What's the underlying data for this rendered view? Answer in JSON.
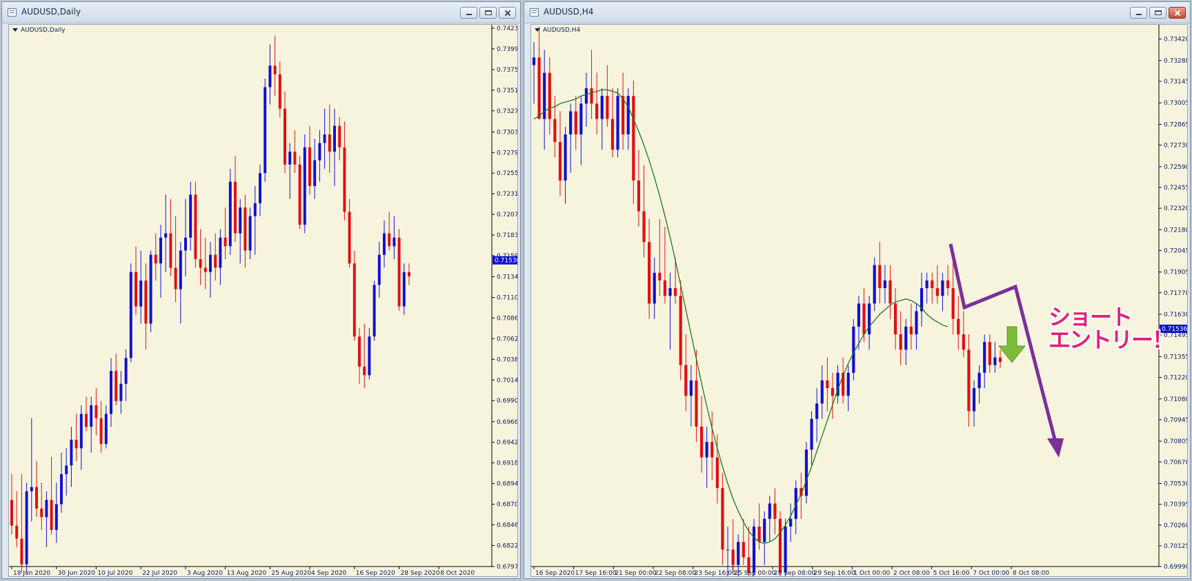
{
  "windows": [
    {
      "id": "daily",
      "title": "AUDUSD,Daily",
      "symbol_label": "AUDUSD,Daily"
    },
    {
      "id": "h4",
      "title": "AUDUSD,H4",
      "symbol_label": "AUDUSD,H4",
      "annotation": [
        "ショート",
        "エントリー！"
      ]
    }
  ],
  "colors": {
    "background": "#f7f4de",
    "bull": "#1010d0",
    "bear": "#e01010",
    "ma": "#1a7a1a",
    "bid_label": "#1010d0",
    "arrow": "#7b2f9b",
    "entry_arrow": "#7cbc3a",
    "annotation": "#e51e78"
  },
  "chart_data": [
    {
      "type": "candlestick",
      "title": "AUDUSD,Daily",
      "ylim": [
        0.67975,
        0.74235
      ],
      "y_ticks": [
        "0.74235",
        "0.73995",
        "0.73755",
        "0.73515",
        "0.73275",
        "0.73030",
        "0.72790",
        "0.72550",
        "0.72310",
        "0.72070",
        "0.71830",
        "0.71590",
        "0.71345",
        "0.71105",
        "0.70865",
        "0.70625",
        "0.70385",
        "0.70145",
        "0.69905",
        "0.69660",
        "0.69420",
        "0.69180",
        "0.68940",
        "0.68700",
        "0.68460",
        "0.68220",
        "0.67975"
      ],
      "x_ticks": [
        "18 Jun 2020",
        "30 Jun 2020",
        "10 Jul 2020",
        "22 Jul 2020",
        "3 Aug 2020",
        "13 Aug 2020",
        "25 Aug 2020",
        "4 Sep 2020",
        "16 Sep 2020",
        "28 Sep 2020",
        "8 Oct 2020"
      ],
      "x_tick_index": [
        0,
        9,
        17,
        26,
        35,
        43,
        52,
        60,
        69,
        78,
        86
      ],
      "current_price": "0.71536",
      "ohlc": [
        [
          0.6875,
          0.6905,
          0.6835,
          0.6845
        ],
        [
          0.6845,
          0.6885,
          0.682,
          0.683
        ],
        [
          0.683,
          0.6905,
          0.679,
          0.68
        ],
        [
          0.68,
          0.6895,
          0.679,
          0.6885
        ],
        [
          0.6885,
          0.697,
          0.685,
          0.689
        ],
        [
          0.689,
          0.692,
          0.6855,
          0.6865
        ],
        [
          0.6865,
          0.6895,
          0.684,
          0.6855
        ],
        [
          0.6855,
          0.6885,
          0.682,
          0.6875
        ],
        [
          0.6875,
          0.6925,
          0.6835,
          0.684
        ],
        [
          0.684,
          0.6895,
          0.6825,
          0.687
        ],
        [
          0.687,
          0.693,
          0.686,
          0.6905
        ],
        [
          0.6905,
          0.6935,
          0.688,
          0.6915
        ],
        [
          0.6915,
          0.696,
          0.689,
          0.6945
        ],
        [
          0.6945,
          0.6975,
          0.692,
          0.6935
        ],
        [
          0.6935,
          0.6985,
          0.691,
          0.6975
        ],
        [
          0.6975,
          0.6995,
          0.6955,
          0.696
        ],
        [
          0.696,
          0.6995,
          0.693,
          0.6985
        ],
        [
          0.6985,
          0.7005,
          0.695,
          0.697
        ],
        [
          0.697,
          0.699,
          0.693,
          0.694
        ],
        [
          0.694,
          0.6985,
          0.6935,
          0.6975
        ],
        [
          0.6975,
          0.704,
          0.696,
          0.7025
        ],
        [
          0.7025,
          0.7045,
          0.6985,
          0.699
        ],
        [
          0.699,
          0.7025,
          0.6975,
          0.701
        ],
        [
          0.701,
          0.705,
          0.699,
          0.704
        ],
        [
          0.704,
          0.715,
          0.7035,
          0.714
        ],
        [
          0.714,
          0.717,
          0.709,
          0.71
        ],
        [
          0.71,
          0.7165,
          0.708,
          0.713
        ],
        [
          0.713,
          0.715,
          0.705,
          0.708
        ],
        [
          0.708,
          0.7165,
          0.707,
          0.716
        ],
        [
          0.716,
          0.7185,
          0.713,
          0.715
        ],
        [
          0.715,
          0.7195,
          0.711,
          0.718
        ],
        [
          0.718,
          0.723,
          0.714,
          0.7185
        ],
        [
          0.7185,
          0.7225,
          0.7135,
          0.7145
        ],
        [
          0.7145,
          0.7205,
          0.7105,
          0.712
        ],
        [
          0.712,
          0.7175,
          0.708,
          0.7165
        ],
        [
          0.7165,
          0.7225,
          0.7135,
          0.718
        ],
        [
          0.718,
          0.7245,
          0.7165,
          0.723
        ],
        [
          0.723,
          0.7245,
          0.7145,
          0.7155
        ],
        [
          0.7155,
          0.719,
          0.7125,
          0.7145
        ],
        [
          0.7145,
          0.718,
          0.712,
          0.714
        ],
        [
          0.714,
          0.7175,
          0.711,
          0.716
        ],
        [
          0.716,
          0.7185,
          0.713,
          0.7145
        ],
        [
          0.7145,
          0.719,
          0.7125,
          0.718
        ],
        [
          0.718,
          0.7215,
          0.7155,
          0.717
        ],
        [
          0.717,
          0.726,
          0.716,
          0.7245
        ],
        [
          0.7245,
          0.7275,
          0.7175,
          0.7185
        ],
        [
          0.7185,
          0.7225,
          0.715,
          0.7215
        ],
        [
          0.7215,
          0.723,
          0.7145,
          0.7165
        ],
        [
          0.7165,
          0.7215,
          0.7155,
          0.7205
        ],
        [
          0.7205,
          0.724,
          0.716,
          0.722
        ],
        [
          0.722,
          0.7265,
          0.7205,
          0.7255
        ],
        [
          0.7255,
          0.7365,
          0.7245,
          0.7355
        ],
        [
          0.7355,
          0.7405,
          0.7335,
          0.738
        ],
        [
          0.738,
          0.7415,
          0.7345,
          0.737
        ],
        [
          0.737,
          0.7385,
          0.732,
          0.733
        ],
        [
          0.733,
          0.735,
          0.7255,
          0.7265
        ],
        [
          0.7265,
          0.729,
          0.7225,
          0.728
        ],
        [
          0.728,
          0.7305,
          0.7255,
          0.7265
        ],
        [
          0.7265,
          0.7275,
          0.719,
          0.7195
        ],
        [
          0.7195,
          0.73,
          0.7185,
          0.7285
        ],
        [
          0.7285,
          0.731,
          0.723,
          0.724
        ],
        [
          0.724,
          0.7295,
          0.7225,
          0.727
        ],
        [
          0.727,
          0.7305,
          0.7245,
          0.729
        ],
        [
          0.729,
          0.733,
          0.726,
          0.73
        ],
        [
          0.73,
          0.7335,
          0.7255,
          0.728
        ],
        [
          0.728,
          0.733,
          0.724,
          0.731
        ],
        [
          0.731,
          0.732,
          0.727,
          0.7285
        ],
        [
          0.7285,
          0.7315,
          0.72,
          0.721
        ],
        [
          0.721,
          0.7225,
          0.7145,
          0.715
        ],
        [
          0.715,
          0.7165,
          0.706,
          0.7065
        ],
        [
          0.7065,
          0.7075,
          0.701,
          0.703
        ],
        [
          0.703,
          0.708,
          0.7005,
          0.702
        ],
        [
          0.702,
          0.7075,
          0.7015,
          0.7065
        ],
        [
          0.7065,
          0.713,
          0.706,
          0.7125
        ],
        [
          0.7125,
          0.7175,
          0.711,
          0.716
        ],
        [
          0.716,
          0.72,
          0.7145,
          0.7185
        ],
        [
          0.7185,
          0.721,
          0.7165,
          0.717
        ],
        [
          0.717,
          0.7205,
          0.7155,
          0.718
        ],
        [
          0.718,
          0.719,
          0.7095,
          0.71
        ],
        [
          0.71,
          0.715,
          0.709,
          0.714
        ],
        [
          0.714,
          0.715,
          0.7125,
          0.7135
        ]
      ]
    },
    {
      "type": "candlestick",
      "title": "AUDUSD,H4",
      "ylim": [
        0.6999,
        0.7349
      ],
      "y_ticks": [
        "0.73420",
        "0.73280",
        "0.73145",
        "0.73005",
        "0.72865",
        "0.72730",
        "0.72590",
        "0.72455",
        "0.72320",
        "0.72180",
        "0.72045",
        "0.71905",
        "0.71770",
        "0.71630",
        "0.71495",
        "0.71355",
        "0.71220",
        "0.71080",
        "0.70945",
        "0.70805",
        "0.70670",
        "0.70530",
        "0.70395",
        "0.70260",
        "0.70125",
        "0.69990"
      ],
      "x_ticks": [
        "16 Sep 2020",
        "17 Sep 16:00",
        "21 Sep 00:00",
        "22 Sep 08:00",
        "23 Sep 16:00",
        "25 Sep 00:00",
        "28 Sep 08:00",
        "29 Sep 16:00",
        "1 Oct 00:00",
        "2 Oct 08:00",
        "5 Oct 16:00",
        "7 Oct 00:00",
        "8 Oct 08:00"
      ],
      "current_price": "0.71536",
      "ohlc": [
        [
          0.7325,
          0.734,
          0.73,
          0.733
        ],
        [
          0.733,
          0.735,
          0.729,
          0.729
        ],
        [
          0.729,
          0.7335,
          0.727,
          0.732
        ],
        [
          0.732,
          0.733,
          0.728,
          0.729
        ],
        [
          0.729,
          0.7305,
          0.7265,
          0.7275
        ],
        [
          0.7275,
          0.7295,
          0.724,
          0.725
        ],
        [
          0.725,
          0.7285,
          0.7235,
          0.728
        ],
        [
          0.728,
          0.73,
          0.7255,
          0.7295
        ],
        [
          0.7295,
          0.7305,
          0.727,
          0.728
        ],
        [
          0.728,
          0.7305,
          0.726,
          0.73
        ],
        [
          0.73,
          0.732,
          0.7285,
          0.731
        ],
        [
          0.731,
          0.7335,
          0.729,
          0.73
        ],
        [
          0.73,
          0.732,
          0.728,
          0.729
        ],
        [
          0.729,
          0.731,
          0.727,
          0.7305
        ],
        [
          0.7305,
          0.7325,
          0.7285,
          0.729
        ],
        [
          0.729,
          0.731,
          0.7265,
          0.727
        ],
        [
          0.727,
          0.731,
          0.7265,
          0.7305
        ],
        [
          0.7305,
          0.732,
          0.727,
          0.728
        ],
        [
          0.728,
          0.731,
          0.727,
          0.7305
        ],
        [
          0.7305,
          0.7315,
          0.7235,
          0.725
        ],
        [
          0.725,
          0.727,
          0.722,
          0.723
        ],
        [
          0.723,
          0.726,
          0.72,
          0.721
        ],
        [
          0.721,
          0.7225,
          0.716,
          0.717
        ],
        [
          0.717,
          0.72,
          0.716,
          0.719
        ],
        [
          0.719,
          0.7225,
          0.7175,
          0.7185
        ],
        [
          0.7185,
          0.722,
          0.717,
          0.7175
        ],
        [
          0.7175,
          0.719,
          0.714,
          0.718
        ],
        [
          0.718,
          0.72,
          0.717,
          0.7175
        ],
        [
          0.7175,
          0.7185,
          0.712,
          0.713
        ],
        [
          0.713,
          0.715,
          0.71,
          0.711
        ],
        [
          0.711,
          0.713,
          0.709,
          0.712
        ],
        [
          0.712,
          0.714,
          0.708,
          0.709
        ],
        [
          0.709,
          0.711,
          0.706,
          0.707
        ],
        [
          0.707,
          0.709,
          0.705,
          0.708
        ],
        [
          0.708,
          0.71,
          0.7055,
          0.707
        ],
        [
          0.707,
          0.7085,
          0.704,
          0.705
        ],
        [
          0.705,
          0.706,
          0.7,
          0.701
        ],
        [
          0.701,
          0.7025,
          0.699,
          0.701
        ],
        [
          0.701,
          0.703,
          0.6995,
          0.7
        ],
        [
          0.7,
          0.702,
          0.6985,
          0.7015
        ],
        [
          0.7015,
          0.703,
          0.7,
          0.7005
        ],
        [
          0.7005,
          0.7025,
          0.699,
          0.6995
        ],
        [
          0.6995,
          0.703,
          0.6985,
          0.7025
        ],
        [
          0.7025,
          0.704,
          0.701,
          0.7015
        ],
        [
          0.7015,
          0.7035,
          0.7,
          0.703
        ],
        [
          0.703,
          0.7045,
          0.7015,
          0.704
        ],
        [
          0.704,
          0.705,
          0.702,
          0.703
        ],
        [
          0.703,
          0.7035,
          0.699,
          0.6995
        ],
        [
          0.6995,
          0.703,
          0.6985,
          0.7025
        ],
        [
          0.7025,
          0.704,
          0.7015,
          0.703
        ],
        [
          0.703,
          0.7055,
          0.702,
          0.705
        ],
        [
          0.705,
          0.706,
          0.703,
          0.7045
        ],
        [
          0.7045,
          0.708,
          0.704,
          0.7075
        ],
        [
          0.7075,
          0.71,
          0.7065,
          0.7095
        ],
        [
          0.7095,
          0.7115,
          0.708,
          0.7105
        ],
        [
          0.7105,
          0.713,
          0.7095,
          0.712
        ],
        [
          0.712,
          0.7135,
          0.71,
          0.7115
        ],
        [
          0.7115,
          0.7125,
          0.7095,
          0.711
        ],
        [
          0.711,
          0.713,
          0.7105,
          0.7125
        ],
        [
          0.7125,
          0.7135,
          0.7105,
          0.711
        ],
        [
          0.711,
          0.713,
          0.71,
          0.7125
        ],
        [
          0.7125,
          0.716,
          0.712,
          0.7155
        ],
        [
          0.7155,
          0.7175,
          0.714,
          0.717
        ],
        [
          0.717,
          0.718,
          0.7145,
          0.715
        ],
        [
          0.715,
          0.7175,
          0.714,
          0.717
        ],
        [
          0.717,
          0.72,
          0.7165,
          0.7195
        ],
        [
          0.7195,
          0.721,
          0.717,
          0.718
        ],
        [
          0.718,
          0.7195,
          0.717,
          0.7185
        ],
        [
          0.7185,
          0.7195,
          0.716,
          0.717
        ],
        [
          0.717,
          0.718,
          0.714,
          0.715
        ],
        [
          0.715,
          0.7165,
          0.713,
          0.714
        ],
        [
          0.714,
          0.716,
          0.713,
          0.7155
        ],
        [
          0.7155,
          0.717,
          0.714,
          0.715
        ],
        [
          0.715,
          0.717,
          0.714,
          0.7165
        ],
        [
          0.7165,
          0.719,
          0.7155,
          0.718
        ],
        [
          0.718,
          0.719,
          0.717,
          0.7185
        ],
        [
          0.7185,
          0.719,
          0.717,
          0.718
        ],
        [
          0.718,
          0.7195,
          0.717,
          0.7175
        ],
        [
          0.7175,
          0.719,
          0.7165,
          0.7185
        ],
        [
          0.7185,
          0.7195,
          0.7175,
          0.718
        ],
        [
          0.718,
          0.7205,
          0.715,
          0.716
        ],
        [
          0.716,
          0.7175,
          0.714,
          0.715
        ],
        [
          0.715,
          0.7165,
          0.7135,
          0.714
        ],
        [
          0.714,
          0.715,
          0.709,
          0.71
        ],
        [
          0.71,
          0.712,
          0.709,
          0.7115
        ],
        [
          0.7115,
          0.713,
          0.7105,
          0.7125
        ],
        [
          0.7125,
          0.715,
          0.7115,
          0.7145
        ],
        [
          0.7145,
          0.715,
          0.7125,
          0.713
        ],
        [
          0.713,
          0.7145,
          0.7125,
          0.7135
        ],
        [
          0.7135,
          0.714,
          0.7128,
          0.7132
        ]
      ],
      "ma_line": [
        0.729,
        0.7292,
        0.7295,
        0.7297,
        0.7298,
        0.73,
        0.7301,
        0.7302,
        0.7303,
        0.7305,
        0.7306,
        0.7307,
        0.7308,
        0.7309,
        0.7309,
        0.7308,
        0.7307,
        0.7303,
        0.7298,
        0.729,
        0.7282,
        0.7273,
        0.7263,
        0.7252,
        0.724,
        0.7227,
        0.7213,
        0.7198,
        0.7182,
        0.7166,
        0.715,
        0.7134,
        0.7118,
        0.7103,
        0.7089,
        0.7076,
        0.7064,
        0.7053,
        0.7043,
        0.7035,
        0.7028,
        0.7022,
        0.7018,
        0.7015,
        0.7014,
        0.7015,
        0.7017,
        0.7021,
        0.7026,
        0.7032,
        0.7039,
        0.7046,
        0.7055,
        0.7064,
        0.7074,
        0.7084,
        0.7094,
        0.7104,
        0.7114,
        0.7123,
        0.7131,
        0.7138,
        0.7144,
        0.715,
        0.7155,
        0.7159,
        0.7163,
        0.7166,
        0.7169,
        0.7171,
        0.7172,
        0.7173,
        0.7172,
        0.717,
        0.7167,
        0.7163,
        0.716,
        0.7158,
        0.7156,
        0.7155
      ]
    }
  ]
}
